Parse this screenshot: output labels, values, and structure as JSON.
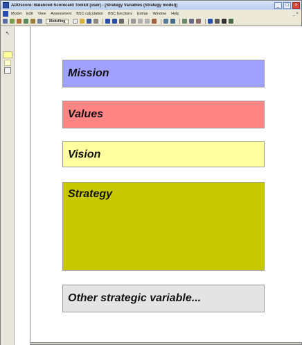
{
  "window": {
    "title": "ADOscore: Balanced Scorecard Toolkit (user) - [Strategy Variables (Strategy model)]",
    "controls": [
      "_",
      "□",
      "×"
    ]
  },
  "menubar": {
    "items": [
      "Model",
      "Edit",
      "View",
      "Assessment",
      "BSC calculation",
      "BSC functions",
      "Extras",
      "Window",
      "Help"
    ],
    "right": "_ ×"
  },
  "toolbar": {
    "mode_label": "Modelling"
  },
  "palette": {
    "pointer": "↖"
  },
  "model": {
    "boxes": [
      {
        "label": "Mission",
        "color": "#a0a0ff"
      },
      {
        "label": "Values",
        "color": "#ff8484"
      },
      {
        "label": "Vision",
        "color": "#ffffa0"
      },
      {
        "label": "Strategy",
        "color": "#c8c800"
      },
      {
        "label": "Other strategic variable...",
        "color": "#e4e4e4"
      }
    ]
  }
}
